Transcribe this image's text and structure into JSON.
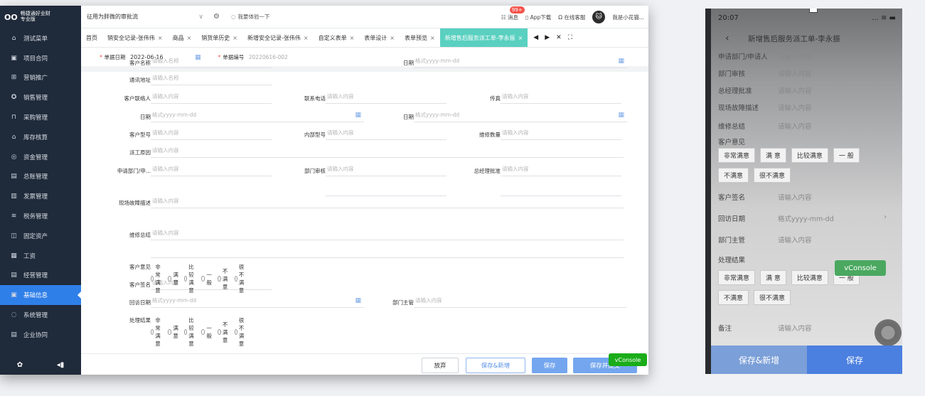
{
  "sidebar": {
    "brand_logo": "OO",
    "brand_name": "畅捷通好业财",
    "brand_sub": "专业版",
    "items": [
      {
        "label": "测试菜单",
        "icon": "home-icon"
      },
      {
        "label": "项目合同",
        "icon": "contract-icon"
      },
      {
        "label": "营销推广",
        "icon": "gift-icon"
      },
      {
        "label": "销售管理",
        "icon": "sales-icon"
      },
      {
        "label": "采购管理",
        "icon": "bag-icon"
      },
      {
        "label": "库存核算",
        "icon": "warehouse-icon"
      },
      {
        "label": "资金管理",
        "icon": "money-icon"
      },
      {
        "label": "总账管理",
        "icon": "ledger-icon"
      },
      {
        "label": "发票管理",
        "icon": "invoice-icon"
      },
      {
        "label": "税务管理",
        "icon": "tax-icon"
      },
      {
        "label": "固定资产",
        "icon": "asset-icon"
      },
      {
        "label": "工资",
        "icon": "salary-icon"
      },
      {
        "label": "经营管理",
        "icon": "report-icon"
      },
      {
        "label": "基础信息",
        "icon": "info-icon"
      },
      {
        "label": "系统管理",
        "icon": "system-icon"
      },
      {
        "label": "企业协同",
        "icon": "collab-icon"
      }
    ],
    "active_index": 13
  },
  "topbar": {
    "flow_select": "征用为胖微的审批流",
    "experience": "我要体验一下",
    "messages": "消息",
    "badge": "99+",
    "app_download": "App下载",
    "online_service": "在线客服",
    "user": "我是小花猫..."
  },
  "tabs": [
    {
      "label": "首页",
      "closable": false
    },
    {
      "label": "销安全记录-张伟伟",
      "closable": true
    },
    {
      "label": "商品",
      "closable": true
    },
    {
      "label": "销货单历史",
      "closable": true
    },
    {
      "label": "新增安全记录-张伟伟",
      "closable": true
    },
    {
      "label": "自定义表单",
      "closable": true
    },
    {
      "label": "表单设计",
      "closable": true
    },
    {
      "label": "表单预览",
      "closable": true
    },
    {
      "label": "新增售后服务派工单-李永振",
      "closable": true,
      "active": true
    }
  ],
  "doc_head": {
    "date_label": "单据日期",
    "date_value": "2022-06-16",
    "no_label": "单据编号",
    "no_value": "20220616-002"
  },
  "form": {
    "customer_name": {
      "label": "客户名称",
      "ph": "请输入名称"
    },
    "date1": {
      "label": "日期",
      "ph": "格式yyyy-mm-dd"
    },
    "address": {
      "label": "通讯地址",
      "ph": "请输入名称"
    },
    "contact": {
      "label": "客户联络人",
      "ph": "请输入内容"
    },
    "phone": {
      "label": "联系电话",
      "ph": "请输入内容"
    },
    "fax": {
      "label": "传真",
      "ph": "请输入内容"
    },
    "date2": {
      "label": "日期",
      "ph": "格式yyyy-mm-dd"
    },
    "date3": {
      "label": "日期",
      "ph": "格式yyyy-mm-dd"
    },
    "cust_model": {
      "label": "客户型号",
      "ph": "请输入内容"
    },
    "inner_model": {
      "label": "内部型号",
      "ph": "请输入内容"
    },
    "repair_qty": {
      "label": "维修数量",
      "ph": "请输入内容"
    },
    "dispatch_reason": {
      "label": "派工原因",
      "ph": "请输入内容"
    },
    "applicant": {
      "label": "申请部门/申...",
      "ph": "请输入内容"
    },
    "dept_review": {
      "label": "部门审核",
      "ph": "请输入内容"
    },
    "gm_approve": {
      "label": "总经理批准",
      "ph": "请输入内容"
    },
    "fault_desc": {
      "label": "现场故障描述",
      "ph": "请输入内容"
    },
    "repair_summary": {
      "label": "维修总结",
      "ph": "请输入内容"
    },
    "opinion": {
      "label": "客户意见"
    },
    "cust_sign": {
      "label": "客户签名",
      "ph": "请输入内容"
    },
    "visit_date": {
      "label": "回访日期",
      "ph": "格式yyyy-mm-dd"
    },
    "dept_head": {
      "label": "部门主管",
      "ph": "请输入内容"
    },
    "result": {
      "label": "处理结果"
    }
  },
  "radio_options": [
    "非常满意",
    "满意",
    "比较满意",
    "一般",
    "不满意",
    "很不满意"
  ],
  "footer": {
    "discard": "放弃",
    "save_new": "保存&新增",
    "save": "保存",
    "save_submit": "保存并提交",
    "vconsole": "vConsole"
  },
  "mobile": {
    "time": "20:07",
    "title": "新增售后服务派工单-李永振",
    "rows": [
      {
        "label": "申请部门/申请人",
        "ph": "请输入内容"
      },
      {
        "label": "部门审核",
        "ph": "请输入内容"
      },
      {
        "label": "总经理批准",
        "ph": "请输入内容"
      },
      {
        "label": "现场故障描述",
        "ph": "请输入内容"
      },
      {
        "label": "维修总结",
        "ph": "请输入内容"
      }
    ],
    "opinion_label": "客户意见",
    "chips": [
      "非常满意",
      "满 意",
      "比较满意",
      "一 般",
      "不满意",
      "很不满意"
    ],
    "sign": {
      "label": "客户签名",
      "ph": "请输入内容"
    },
    "visit": {
      "label": "回访日期",
      "ph": "格式yyyy-mm-dd"
    },
    "head": {
      "label": "部门主管",
      "ph": "请输入内容"
    },
    "result_label": "处理结果",
    "remark": {
      "label": "备注",
      "ph": "请输入内容"
    },
    "save_new": "保存&新增",
    "save": "保存",
    "vconsole": "vConsole"
  }
}
